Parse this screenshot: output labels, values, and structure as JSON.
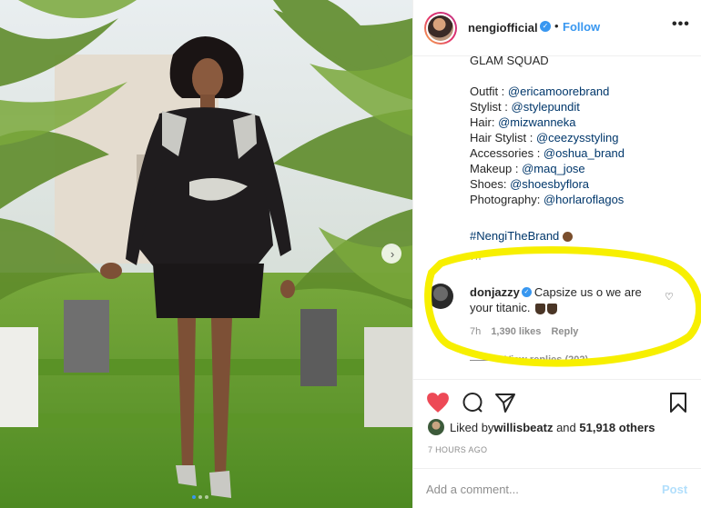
{
  "header": {
    "username": "nengiofficial",
    "follow_sep": "•",
    "follow_label": "Follow",
    "more_label": "•••"
  },
  "caption": {
    "lines": [
      {
        "label": "GLAM SQUAD",
        "handle": ""
      },
      {
        "label": "",
        "handle": ""
      },
      {
        "label": "Outfit : ",
        "handle": "@ericamoorebrand"
      },
      {
        "label": "Stylist : ",
        "handle": "@stylepundit"
      },
      {
        "label": "Hair: ",
        "handle": "@mizwanneka"
      },
      {
        "label": "Hair Stylist : ",
        "handle": "@ceezysstyling"
      },
      {
        "label": "Accessories : ",
        "handle": "@oshua_brand"
      },
      {
        "label": "Makeup : ",
        "handle": "@maq_jose"
      },
      {
        "label": "Shoes: ",
        "handle": "@shoesbyflora"
      },
      {
        "label": "Photography: ",
        "handle": "@horlaroflagos"
      },
      {
        "label": "",
        "handle": ""
      },
      {
        "label": "",
        "handle": "#NengiTheBrand"
      }
    ],
    "time": "7h"
  },
  "comment": {
    "username": "donjazzy",
    "text": "Capsize us o we are your titanic.",
    "time": "7h",
    "likes": "1,390 likes",
    "reply": "Reply",
    "view_replies": "View replies (202)"
  },
  "likes": {
    "prefix": "Liked by ",
    "user": "willisbeatz",
    "middle": " and ",
    "others": "51,918 others"
  },
  "timestamp": "7 HOURS AGO",
  "add_comment": {
    "placeholder": "Add a comment...",
    "post_label": "Post"
  },
  "colors": {
    "accent": "#3897f0",
    "like_red": "#ed4956",
    "highlight_yellow": "#f7ef00",
    "post_disabled": "#b2dffc"
  },
  "icons": [
    "heart-icon",
    "comment-icon",
    "share-icon",
    "bookmark-icon",
    "verified-icon",
    "more-icon",
    "chevron-right-icon"
  ]
}
